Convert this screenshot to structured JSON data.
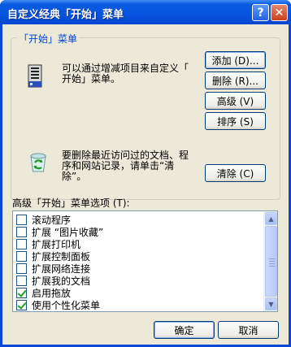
{
  "window": {
    "title": "自定义经典「开始」菜单",
    "help_glyph": "?",
    "close_glyph": "✕"
  },
  "group": {
    "legend": "「开始」菜单",
    "customize_text": "可以通过增减项目来自定义「\n开始」菜单。",
    "clear_text": "要删除最近访问过的文档、程\n序和网站记录，请单击“清\n除”。"
  },
  "buttons": {
    "add": "添加 (D)...",
    "remove": "删除 (R)...",
    "advanced": "高级 (V)",
    "sort": "排序 (S)",
    "clear": "清除 (C)",
    "ok": "确定",
    "cancel": "取消"
  },
  "options": {
    "label": "高级「开始」菜单选项 (T):",
    "items": [
      {
        "label": "滚动程序",
        "checked": false
      },
      {
        "label": "扩展 “图片收藏”",
        "checked": false
      },
      {
        "label": "扩展打印机",
        "checked": false
      },
      {
        "label": "扩展控制面板",
        "checked": false
      },
      {
        "label": "扩展网络连接",
        "checked": false
      },
      {
        "label": "扩展我的文档",
        "checked": false
      },
      {
        "label": "启用拖放",
        "checked": true
      },
      {
        "label": "使用个性化菜单",
        "checked": true
      }
    ]
  },
  "icons": {
    "menu": "start-menu-icon",
    "recycle": "recycle-bin-icon"
  },
  "colors": {
    "titlebar": "#0553df",
    "dialog_bg": "#ece9d8",
    "legend_text": "#0046d5",
    "button_border": "#003c74"
  }
}
